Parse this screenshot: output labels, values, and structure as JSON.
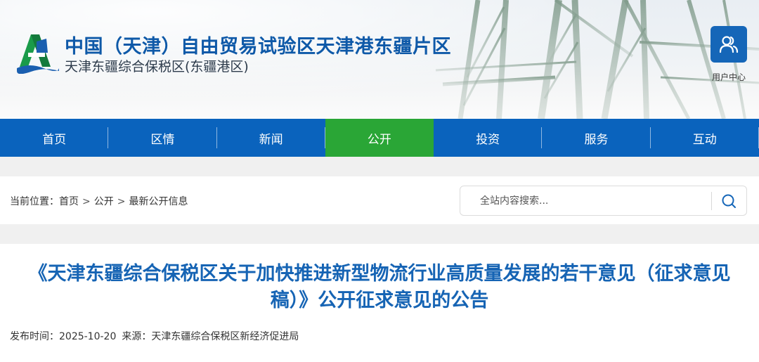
{
  "header": {
    "title": "中国（天津）自由贸易试验区天津港东疆片区",
    "subtitle": "天津东疆综合保税区(东疆港区)",
    "user_center_label": "用户中心"
  },
  "nav": {
    "items": [
      {
        "label": "首页"
      },
      {
        "label": "区情"
      },
      {
        "label": "新闻"
      },
      {
        "label": "公开"
      },
      {
        "label": "投资"
      },
      {
        "label": "服务"
      },
      {
        "label": "互动"
      }
    ],
    "active_index": 3
  },
  "breadcrumb": {
    "prefix": "当前位置：",
    "items": [
      "首页",
      "公开",
      "最新公开信息"
    ],
    "separator": ">"
  },
  "search": {
    "placeholder": "全站内容搜索..."
  },
  "article": {
    "title": "《天津东疆综合保税区关于加快推进新型物流行业高质量发展的若干意见（征求意见稿）》公开征求意见的公告",
    "publish_label": "发布时间：",
    "publish_date": "2025-10-20",
    "source_label": "来源：",
    "source": "天津东疆综合保税区新经济促进局"
  },
  "colors": {
    "nav_bg": "#0a63bd",
    "nav_active": "#2aa636",
    "title_blue": "#1664b4",
    "brand_blue": "#0e59a8"
  },
  "icons": {
    "logo": "dongjiang-logo",
    "user": "user-group-icon",
    "search": "search-icon"
  }
}
